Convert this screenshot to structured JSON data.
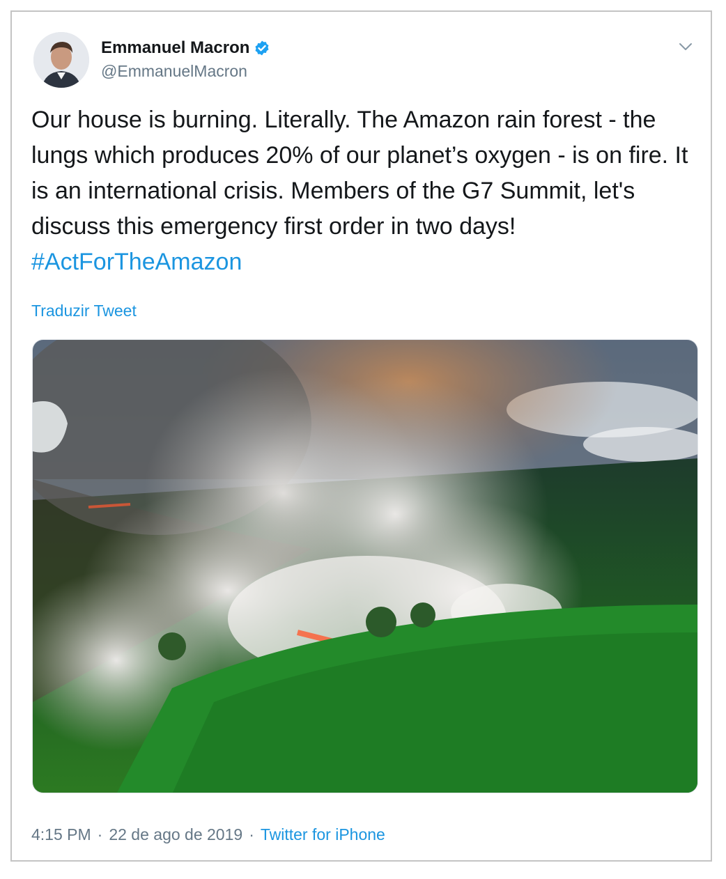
{
  "tweet": {
    "author_name": "Emmanuel Macron",
    "handle": "@EmmanuelMacron",
    "text": "Our house is burning. Literally. The Amazon rain forest - the lungs which produces 20% of our planet’s oxygen - is on fire. It is an international crisis. Members of the G7 Summit, let's discuss this emergency first order in two days!",
    "hashtag": "#ActForTheAmazon",
    "translate_label": "Traduzir Tweet",
    "time": "4:15 PM",
    "date": "22 de ago de 2019",
    "source": "Twitter for iPhone",
    "separator": "·"
  },
  "icons": {
    "verified": "verified-badge-icon",
    "menu": "chevron-down-icon"
  },
  "colors": {
    "link": "#1b95e0",
    "text": "#14171a",
    "secondary": "#657786",
    "verified": "#1da1f2"
  }
}
